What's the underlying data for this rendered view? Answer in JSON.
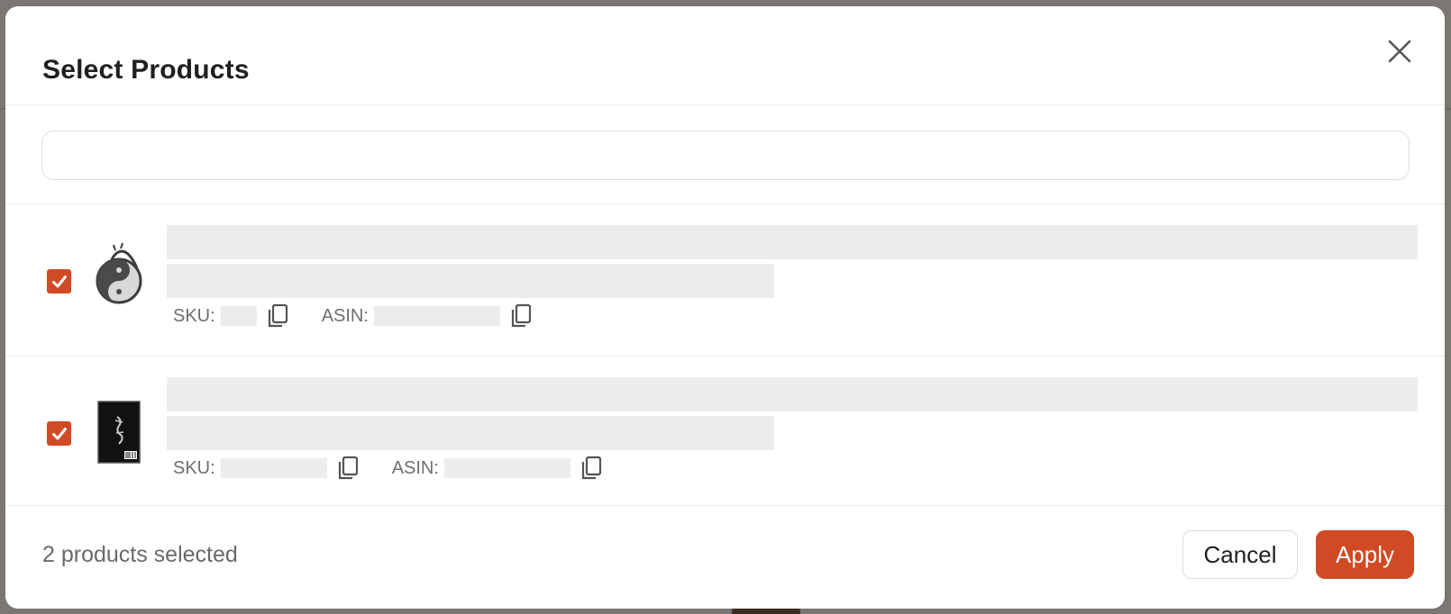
{
  "modal": {
    "title": "Select Products"
  },
  "search": {
    "value": "",
    "placeholder": ""
  },
  "products": [
    {
      "checked": true,
      "sku_label": "SKU:",
      "asin_label": "ASIN:",
      "thumbnail": "dragon-yin-yang-emblem"
    },
    {
      "checked": true,
      "sku_label": "SKU:",
      "asin_label": "ASIN:",
      "thumbnail": "black-book-cover-with-dragon"
    }
  ],
  "footer": {
    "status": "2 products selected",
    "cancel_label": "Cancel",
    "apply_label": "Apply"
  },
  "colors": {
    "accent": "#d04a25",
    "redaction": "#eeeded",
    "backdrop": "#7a7672"
  },
  "icons": [
    "close-icon",
    "checkmark-icon",
    "copy-icon"
  ]
}
